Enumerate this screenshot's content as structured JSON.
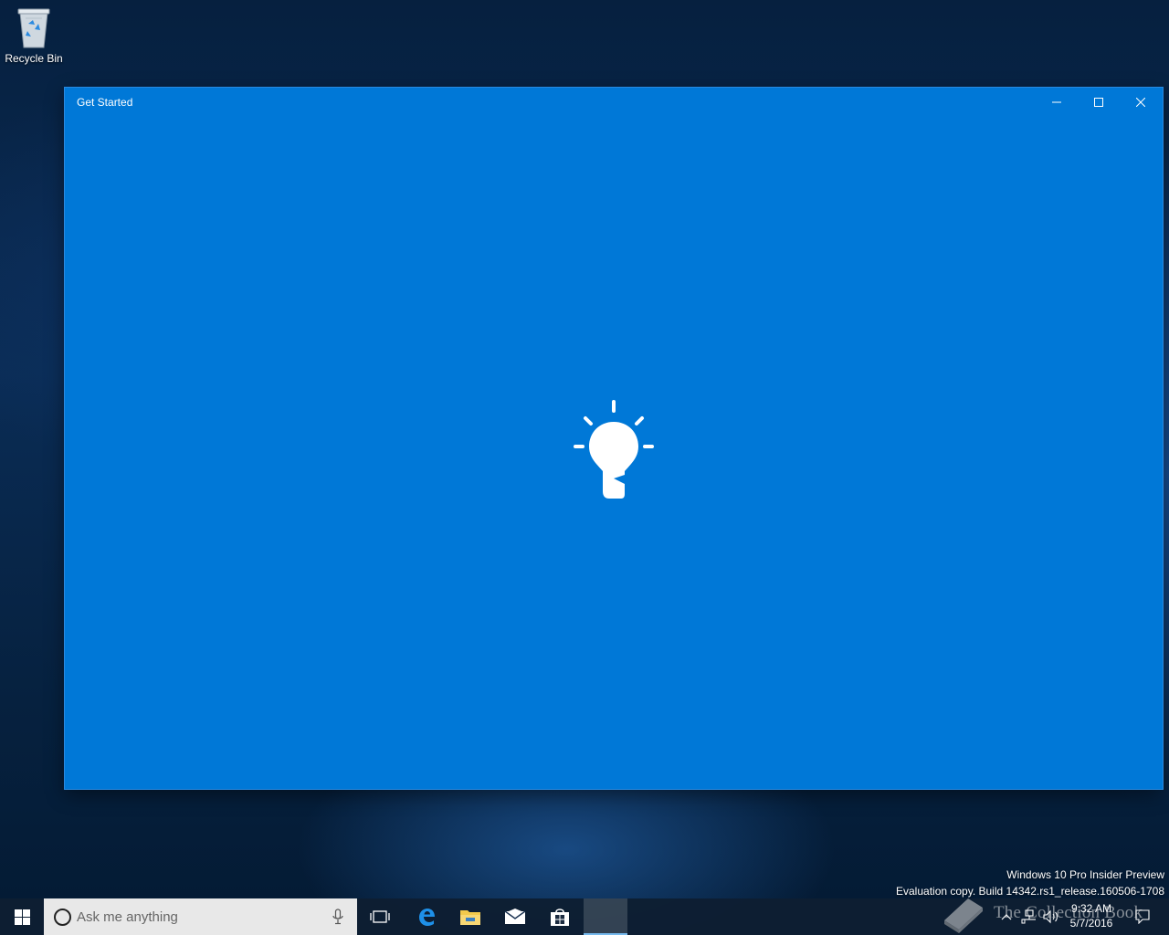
{
  "desktop": {
    "recycle_bin_label": "Recycle Bin"
  },
  "window": {
    "title": "Get Started",
    "background_color": "#0078d7",
    "splash_icon": "lightbulb-icon",
    "controls": [
      "minimize-icon",
      "maximize-icon",
      "close-icon"
    ]
  },
  "watermark": {
    "line1": "Windows 10 Pro Insider Preview",
    "line2": "Evaluation copy. Build 14342.rs1_release.160506-1708"
  },
  "taskbar": {
    "search_placeholder": "Ask me anything",
    "pinned": [
      "windows-logo-icon",
      "task-view-icon",
      "edge-icon",
      "file-explorer-icon",
      "mail-icon",
      "store-icon",
      "get-started-icon"
    ],
    "tray_icons": [
      "chevron-up-icon",
      "network-icon",
      "volume-icon"
    ],
    "time": "9:32 AM",
    "date": "5/7/2016",
    "accent_color": "#76b9ed"
  },
  "brand_overlay": {
    "text": "The Collection Book"
  }
}
